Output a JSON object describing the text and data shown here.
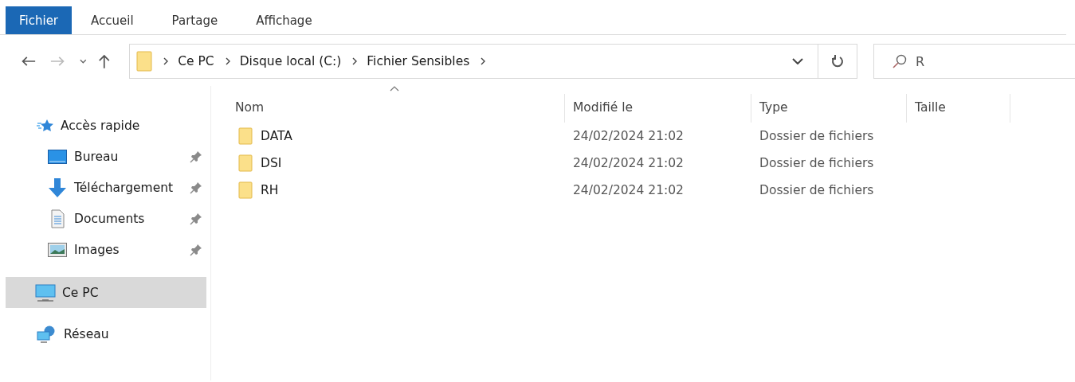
{
  "ribbon_tabs": [
    {
      "label": "Fichier",
      "selected": true
    },
    {
      "label": "Accueil",
      "selected": false
    },
    {
      "label": "Partage",
      "selected": false
    },
    {
      "label": "Affichage",
      "selected": false
    }
  ],
  "address_bar": {
    "path": [
      "Ce PC",
      "Disque local (C:)",
      "Fichier Sensibles"
    ]
  },
  "search": {
    "placeholder": "R"
  },
  "sidebar": {
    "items": [
      {
        "label": "Accès rapide",
        "selected": false,
        "children": [
          {
            "label": "Bureau",
            "pinned": true
          },
          {
            "label": "Téléchargement",
            "pinned": true
          },
          {
            "label": "Documents",
            "pinned": true
          },
          {
            "label": "Images",
            "pinned": true
          }
        ]
      },
      {
        "label": "Ce PC",
        "selected": true
      },
      {
        "label": "Réseau",
        "selected": false
      }
    ]
  },
  "table": {
    "columns": [
      "Nom",
      "Modifié le",
      "Type",
      "Taille"
    ],
    "rows": [
      {
        "name": "DATA",
        "modified": "24/02/2024 21:02",
        "type": "Dossier de fichiers"
      },
      {
        "name": "DSI",
        "modified": "24/02/2024 21:02",
        "type": "Dossier de fichiers"
      },
      {
        "name": "RH",
        "modified": "24/02/2024 21:02",
        "type": "Dossier de fichiers"
      }
    ]
  }
}
